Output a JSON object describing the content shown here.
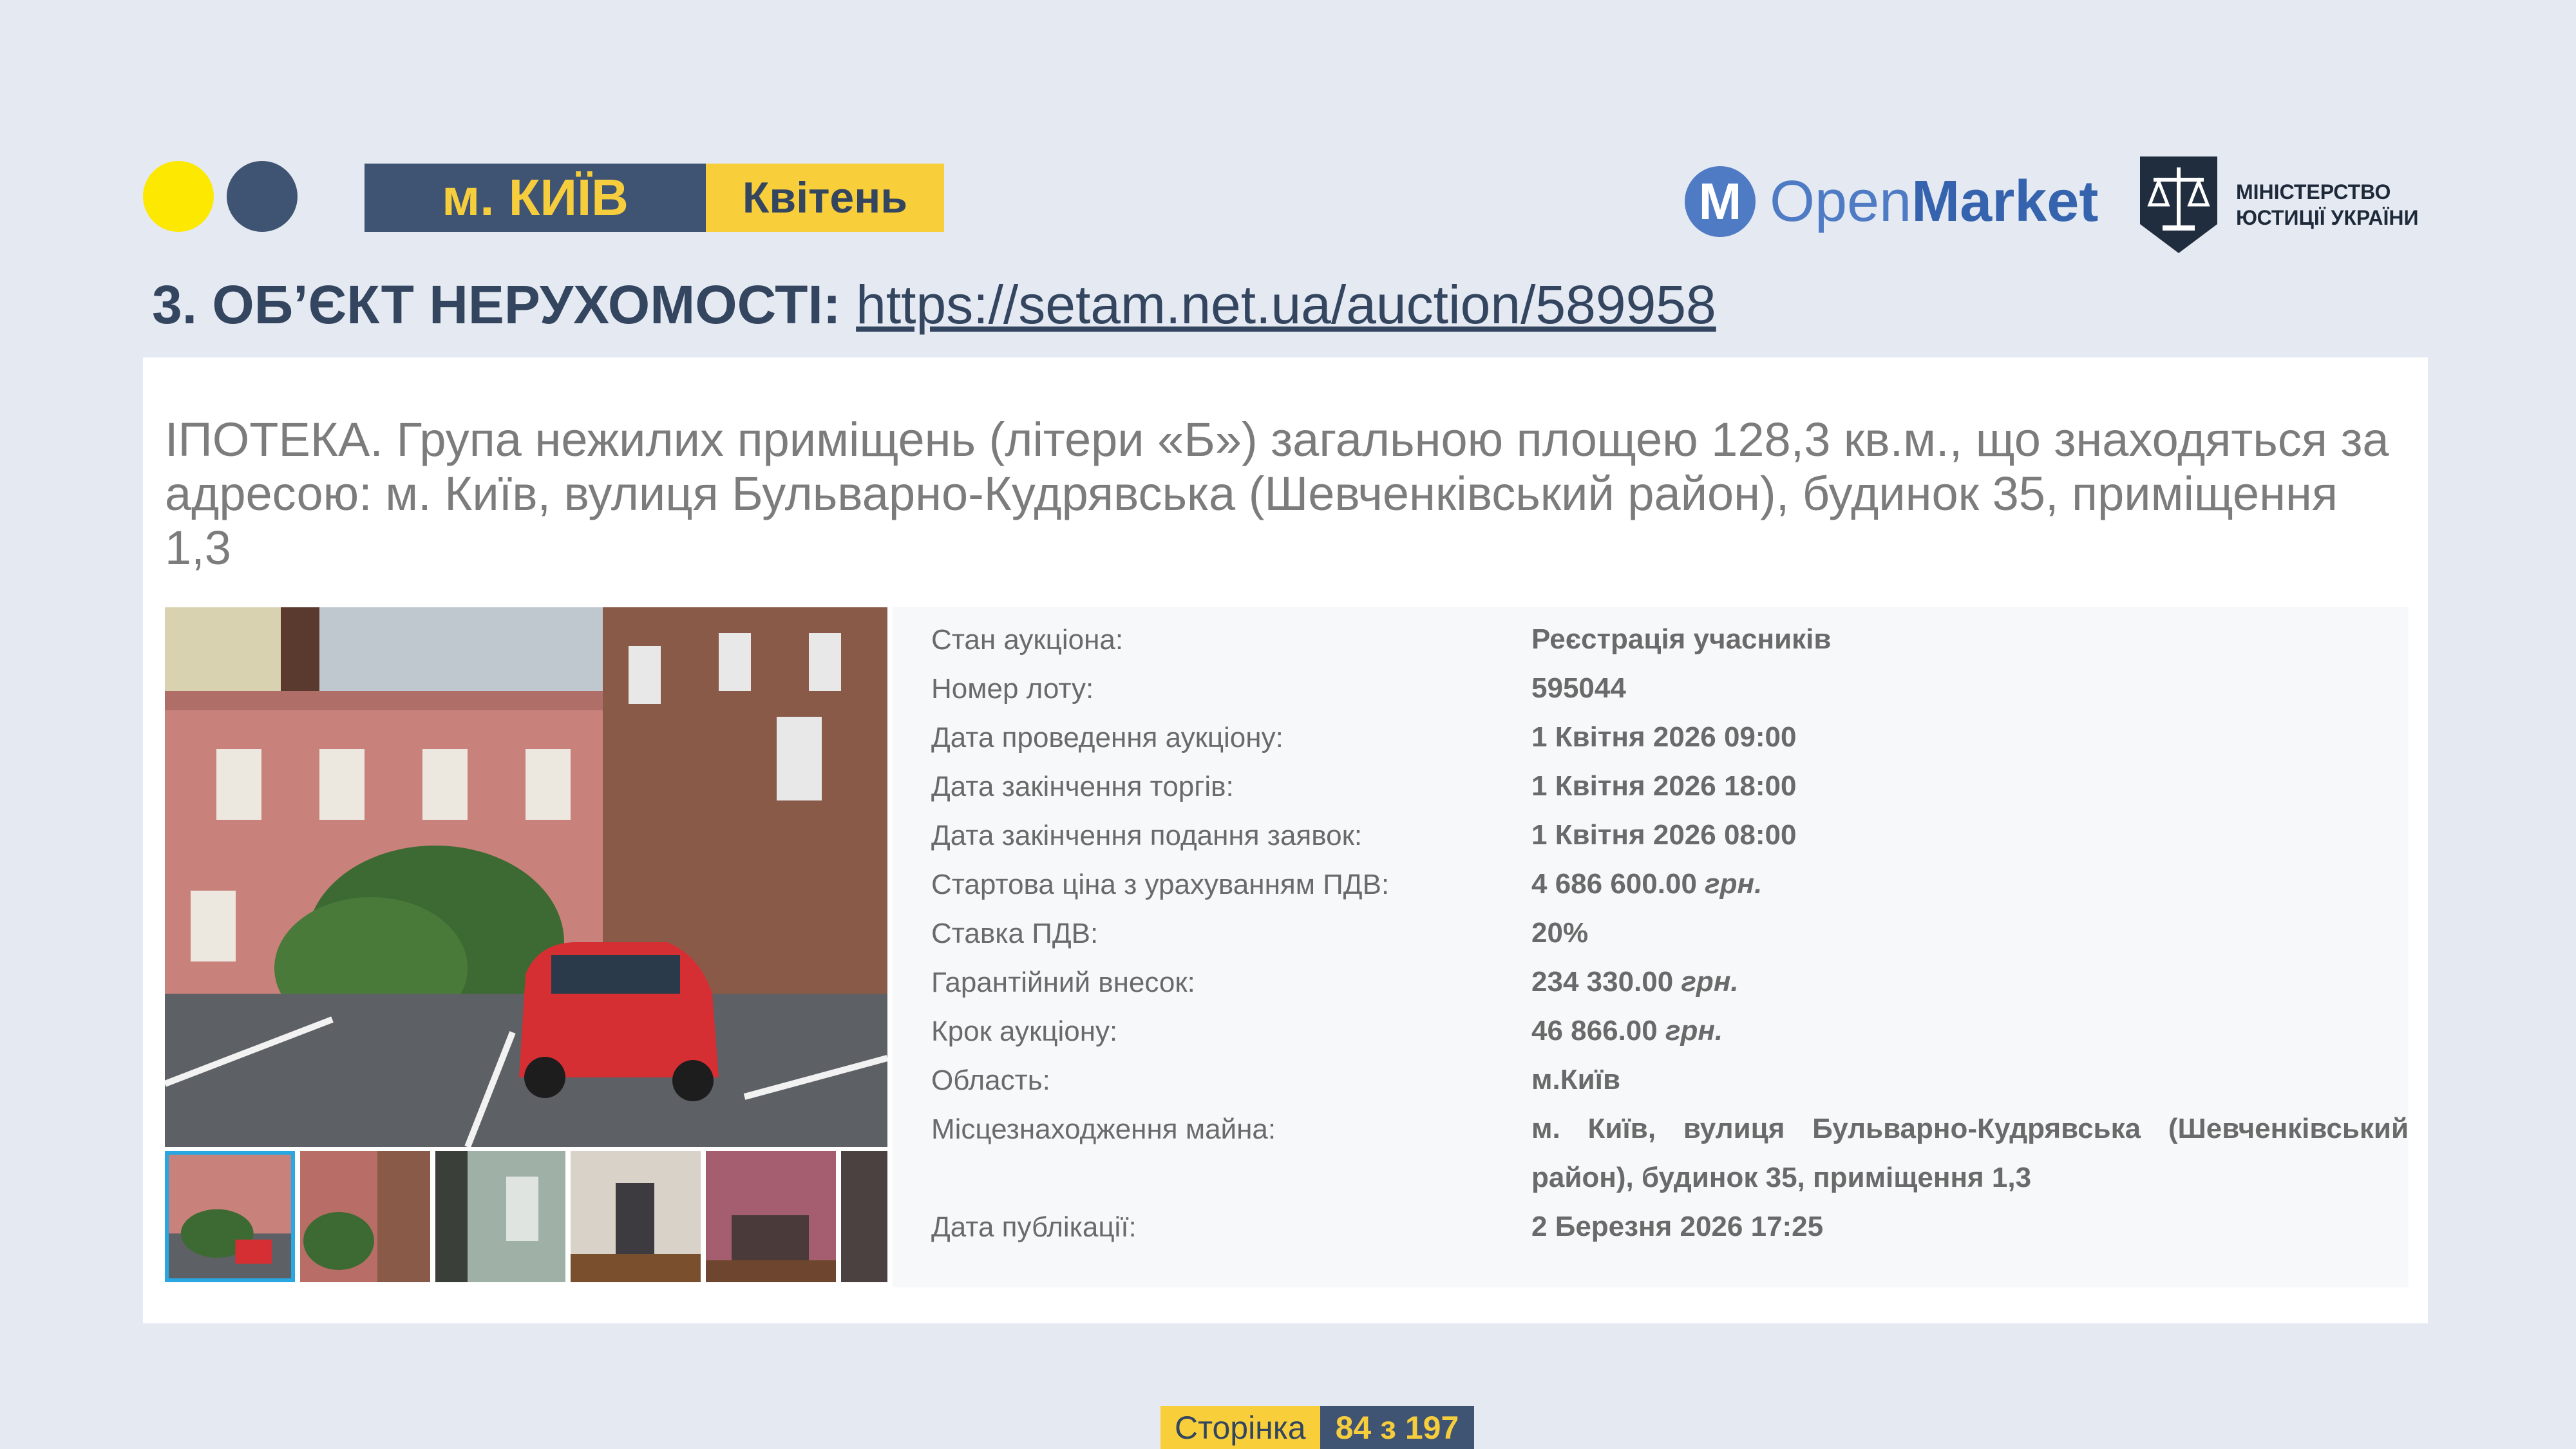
{
  "header": {
    "city": "м. КИЇВ",
    "month": "Квітень",
    "openmarket_logo": {
      "mark": "M",
      "text_open": "Open",
      "text_market": "Market"
    },
    "ministry_logo": {
      "line1": "МІНІСТЕРСТВО",
      "line2": "ЮСТИЦІЇ УКРАЇНИ"
    }
  },
  "section": {
    "title_prefix": "3. ОБ’ЄКТ НЕРУХОМОСТІ:",
    "link": "https://setam.net.ua/auction/589958"
  },
  "listing": {
    "title": "ІПОТЕКА. Група нежилих приміщень (літери «Б») загальною площею 128,3 кв.м., що знаходяться за адресою: м. Київ, вулиця Бульварно-Кудрявська (Шевченківський район), будинок 35, приміщення 1,3",
    "photo_count_visible": 6,
    "details": [
      {
        "label": "Стан аукціона:",
        "value": "Реєстрація учасників"
      },
      {
        "label": "Номер лоту:",
        "value": "595044"
      },
      {
        "label": "Дата проведення аукціону:",
        "value": "1 Квітня 2026 09:00"
      },
      {
        "label": "Дата закінчення торгів:",
        "value": "1 Квітня 2026 18:00"
      },
      {
        "label": "Дата закінчення подання заявок:",
        "value": "1 Квітня 2026 08:00"
      },
      {
        "label": "Стартова ціна з урахуванням ПДВ:",
        "value": "4 686 600.00",
        "unit": "грн."
      },
      {
        "label": "Ставка ПДВ:",
        "value": "20%"
      },
      {
        "label": "Гарантійний внесок:",
        "value": "234 330.00",
        "unit": "грн."
      },
      {
        "label": "Крок аукціону:",
        "value": "46 866.00",
        "unit": "грн."
      },
      {
        "label": "Область:",
        "value": "м.Київ"
      },
      {
        "label": "Місцезнаходження майна:",
        "value": "м. Київ, вулиця Бульварно-Кудрявська (Шевченківський район), будинок 35, приміщення 1,3"
      },
      {
        "label": "Дата публікації:",
        "value": "2 Березня 2026 17:25"
      }
    ]
  },
  "footer": {
    "page_label": "Сторінка",
    "page_number": "84 з 197"
  },
  "colors": {
    "background": "#e4e9f2",
    "navy": "#3f5372",
    "yellow": "#f8cf3a",
    "bright_yellow": "#fce800",
    "openmarket_blue": "#4f7bc4",
    "selected_thumb_border": "#29a7e0"
  }
}
